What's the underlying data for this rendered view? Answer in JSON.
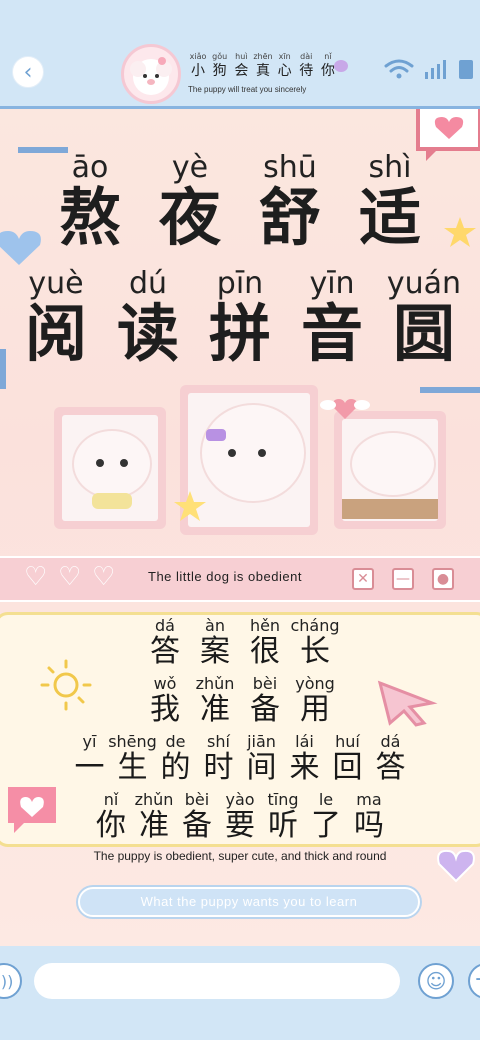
{
  "header": {
    "back_icon": "chevron-left-icon",
    "title_pinyin": [
      "xiǎo",
      "gǒu",
      "huì",
      "zhēn",
      "xīn",
      "dài",
      "nǐ"
    ],
    "title_chars": [
      "小",
      "狗",
      "会",
      "真",
      "心",
      "待",
      "你"
    ],
    "subtitle": "The puppy will treat you sincerely",
    "status_icons": [
      "wifi-icon",
      "signal-icon",
      "battery-icon"
    ]
  },
  "poster": {
    "line1": {
      "pinyin": [
        "āo",
        "yè",
        "shū",
        "shì"
      ],
      "chars": [
        "熬",
        "夜",
        "舒",
        "适"
      ]
    },
    "line2": {
      "pinyin": [
        "yuè",
        "dú",
        "pīn",
        "yīn",
        "yuán"
      ],
      "chars": [
        "阅",
        "读",
        "拼",
        "音",
        "圆"
      ]
    },
    "accent_pink": "#f7cfd3",
    "accent_blue": "#7ea8d8",
    "accent_yellow": "#f4df91"
  },
  "window_bar": {
    "title": "The little dog is obedient",
    "hearts": [
      "pixel-heart-icon",
      "pixel-heart-icon",
      "pixel-heart-icon"
    ],
    "buttons": [
      "close-icon",
      "minimize-icon",
      "record-icon"
    ]
  },
  "card": {
    "lines": [
      {
        "pinyin": [
          "dá",
          "àn",
          "hěn",
          "cháng"
        ],
        "chars": [
          "答",
          "案",
          "很",
          "长"
        ]
      },
      {
        "pinyin": [
          "wǒ",
          "zhǔn",
          "bèi",
          "yòng"
        ],
        "chars": [
          "我",
          "准",
          "备",
          "用"
        ]
      },
      {
        "pinyin": [
          "yī",
          "shēng",
          "de",
          "shí",
          "jiān",
          "lái",
          "huí",
          "dá"
        ],
        "chars": [
          "一",
          "生",
          "的",
          "时",
          "间",
          "来",
          "回",
          "答"
        ]
      },
      {
        "pinyin": [
          "nǐ",
          "zhǔn",
          "bèi",
          "yào",
          "tīng",
          "le",
          "ma"
        ],
        "chars": [
          "你",
          "准",
          "备",
          "要",
          "听",
          "了",
          "吗"
        ]
      }
    ],
    "caption": "The puppy is obedient, super cute, and thick and round"
  },
  "pill": {
    "text": "What the puppy wants you to learn"
  },
  "bottom_bar": {
    "voice_icon": "voice-icon",
    "input_placeholder": "",
    "emoji_icon": "smile-icon",
    "plus_icon": "plus-icon"
  }
}
